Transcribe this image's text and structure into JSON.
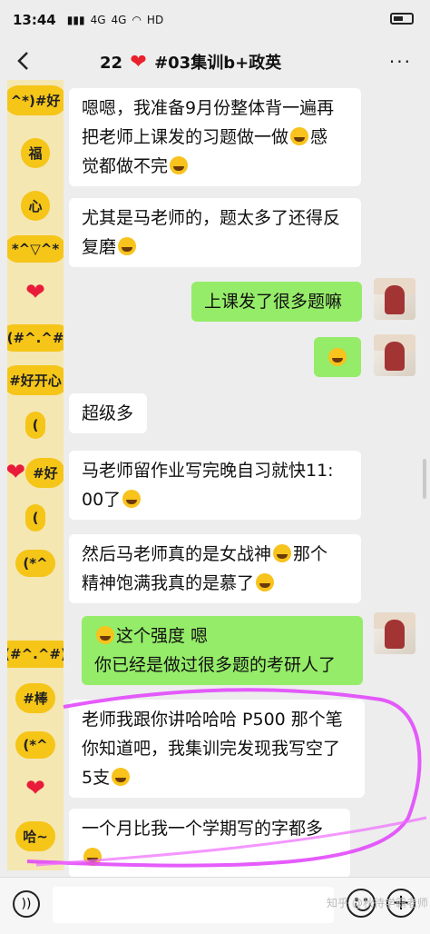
{
  "status": {
    "time": "13:44",
    "net1": "HD",
    "net2": "4G",
    "net3": "4G"
  },
  "header": {
    "title_prefix": "22",
    "title_suffix": "#03集训b+政英",
    "more_label": "···"
  },
  "stickers": [
    "^*)#好",
    "福",
    "心",
    "*^▽^*",
    "(#^.^#",
    "#好开心",
    "(",
    "#好",
    "(",
    "(*^",
    "(#^.^#)",
    "#棒",
    "(*^",
    "",
    "哈~"
  ],
  "messages": [
    {
      "side": "left",
      "lines": [
        "嗯嗯，我准备9月份整体背一遍再",
        "把老师上课发的习题做一做",
        "感",
        "觉都做不完"
      ]
    },
    {
      "side": "left",
      "lines": [
        "尤其是马老师的，题太多了还得反",
        "复磨"
      ]
    },
    {
      "side": "right",
      "lines": [
        "上课发了很多题嘛"
      ]
    },
    {
      "side": "right",
      "lines": [
        ""
      ]
    },
    {
      "side": "left",
      "lines": [
        "超级多"
      ]
    },
    {
      "side": "left",
      "lines": [
        "马老师留作业写完晚自习就快11:",
        "00了"
      ]
    },
    {
      "side": "left",
      "lines": [
        "然后马老师真的是女战神",
        "那个",
        "精神饱满我真的是慕了"
      ]
    },
    {
      "side": "right",
      "lines": [
        "这个强度  嗯",
        "你已经是做过很多题的考研人了"
      ]
    },
    {
      "side": "left",
      "lines": [
        "老师我跟你讲哈哈哈 P500 那个笔",
        "你知道吧，我集训完发现我写空了",
        "5支"
      ]
    },
    {
      "side": "left",
      "lines": [
        "一个月比我一个学期写的字都多"
      ]
    }
  ],
  "watermark": "知乎 @秋待学霸老师",
  "colors": {
    "me_bubble": "#95ec69",
    "other_bubble": "#ffffff",
    "heart": "#e8202c",
    "annotation": "#e040fb"
  }
}
